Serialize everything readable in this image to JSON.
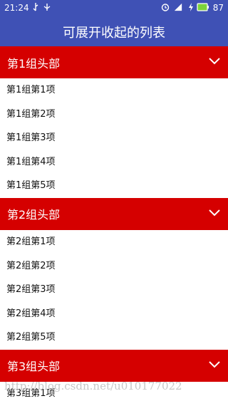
{
  "status_bar": {
    "time": "21:24",
    "battery": "87",
    "icons": [
      "usb-icon",
      "android-debug-icon",
      "alarm-icon",
      "signal-icon",
      "charging-icon",
      "battery-icon"
    ]
  },
  "app_bar": {
    "title": "可展开收起的列表"
  },
  "groups": [
    {
      "title": "第1组头部",
      "items": [
        "第1组第1项",
        "第1组第2项",
        "第1组第3项",
        "第1组第4项",
        "第1组第5项"
      ]
    },
    {
      "title": "第2组头部",
      "items": [
        "第2组第1项",
        "第2组第2项",
        "第2组第3项",
        "第2组第4项",
        "第2组第5项"
      ]
    },
    {
      "title": "第3组头部",
      "items": [
        "第3组第1项"
      ]
    }
  ],
  "watermark": "http://blog.csdn.net/u010177022",
  "colors": {
    "app_bar": "#3f51b5",
    "group_header": "#d50000",
    "list_bg": "#ffffff"
  }
}
